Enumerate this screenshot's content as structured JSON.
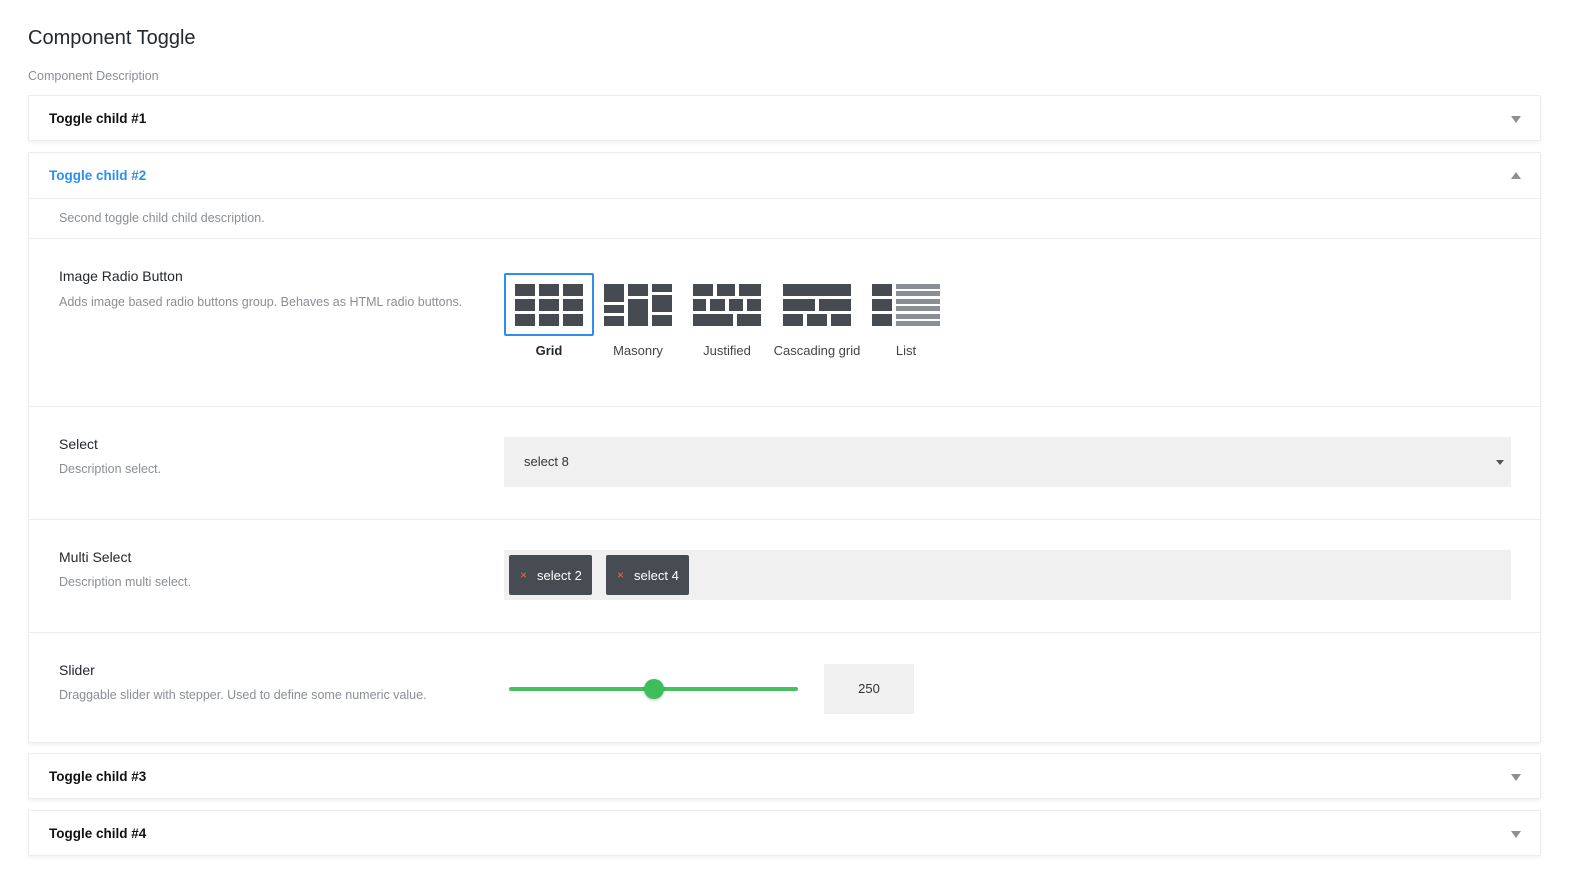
{
  "page": {
    "title": "Component Toggle",
    "description": "Component Description"
  },
  "toggles": [
    {
      "title": "Toggle child #1",
      "expanded": false
    },
    {
      "title": "Toggle child #2",
      "expanded": true,
      "description": "Second toggle child child description."
    },
    {
      "title": "Toggle child #3",
      "expanded": false
    },
    {
      "title": "Toggle child #4",
      "expanded": false
    }
  ],
  "image_radio": {
    "label": "Image Radio Button",
    "help": "Adds image based radio buttons group. Behaves as HTML radio buttons.",
    "options": [
      {
        "label": "Grid",
        "icon": "grid-layout-icon",
        "selected": true
      },
      {
        "label": "Masonry",
        "icon": "masonry-layout-icon",
        "selected": false
      },
      {
        "label": "Justified",
        "icon": "justified-layout-icon",
        "selected": false
      },
      {
        "label": "Cascading grid",
        "icon": "cascading-grid-layout-icon",
        "selected": false
      },
      {
        "label": "List",
        "icon": "list-layout-icon",
        "selected": false
      }
    ]
  },
  "select": {
    "label": "Select",
    "help": "Description select.",
    "value": "select 8"
  },
  "multi_select": {
    "label": "Multi Select",
    "help": "Description multi select.",
    "tags": [
      "select 2",
      "select 4"
    ],
    "remove_glyph": "×"
  },
  "slider": {
    "label": "Slider",
    "help": "Draggable slider with stepper. Used to define some numeric value.",
    "value": "250",
    "fraction": 0.5
  },
  "colors": {
    "accent": "#2a8ff0",
    "slider": "#49c060",
    "tag_bg": "#474c52",
    "icon": "#464b52"
  }
}
